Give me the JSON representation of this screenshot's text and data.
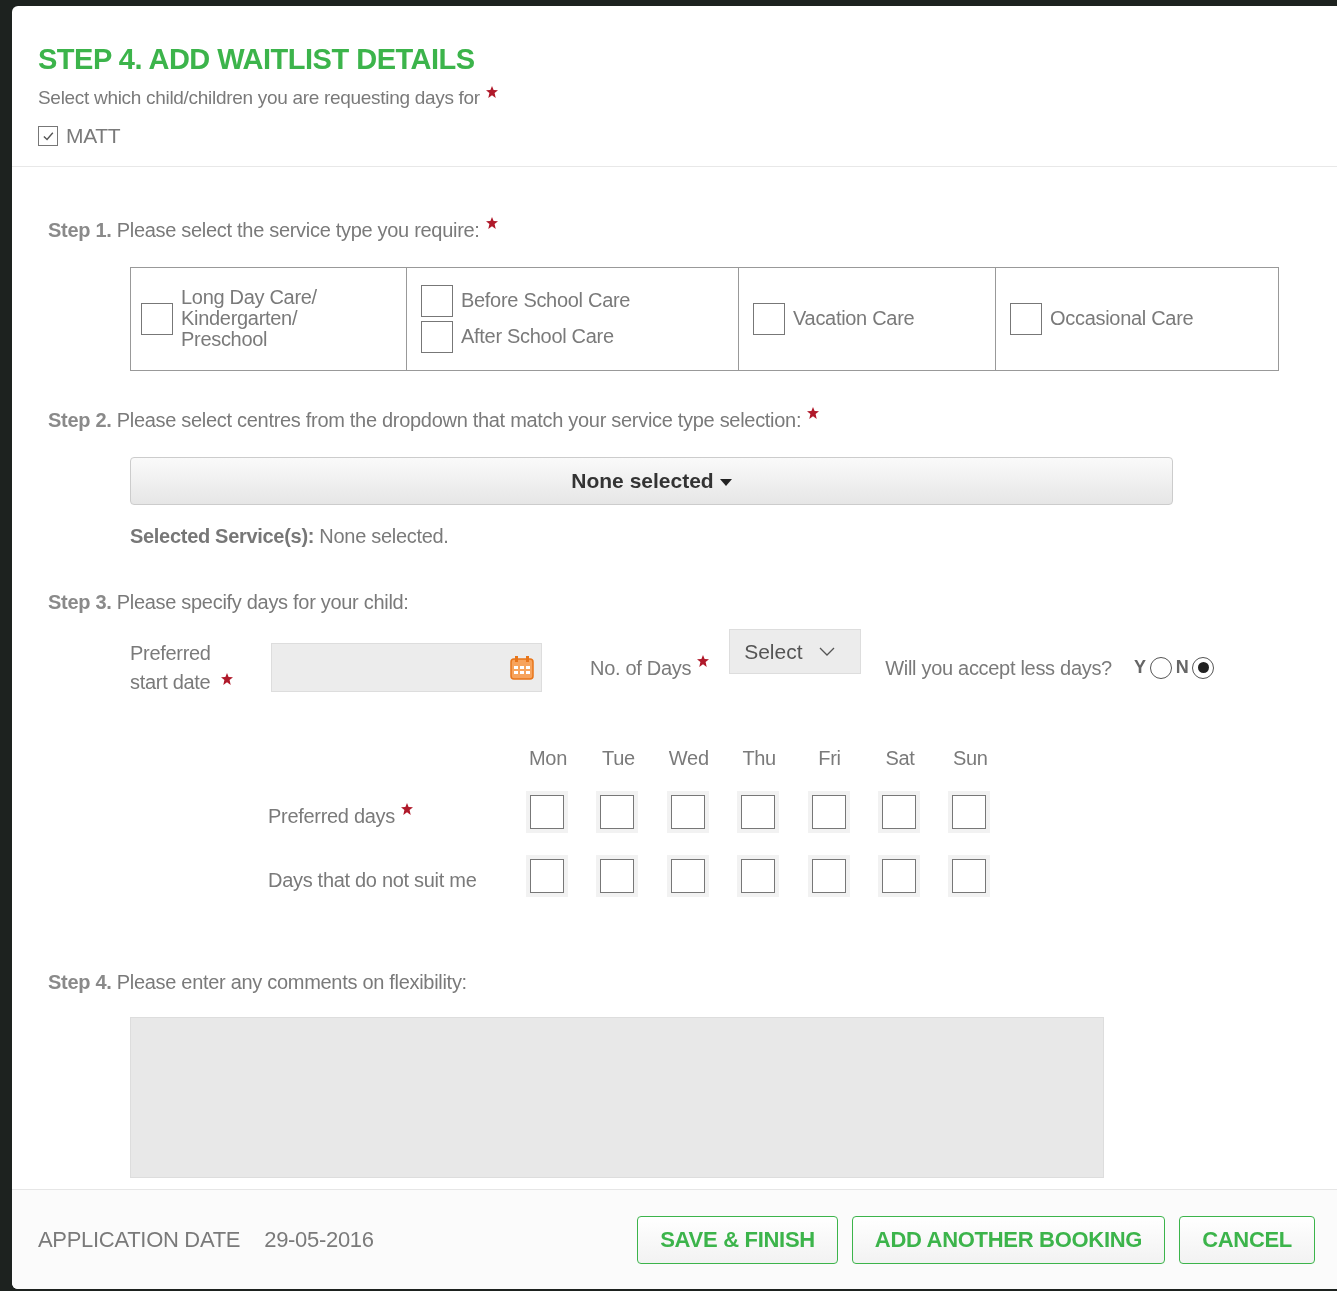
{
  "header": {
    "title": "STEP 4. ADD WAITLIST DETAILS",
    "prompt": "Select which child/children you are requesting days for",
    "prompt_required": true,
    "children": [
      {
        "label": "MATT",
        "checked": true
      }
    ]
  },
  "step1": {
    "number": "Step 1.",
    "text": "Please select the service type you require:",
    "required": true,
    "groups": [
      [
        {
          "label": "Long Day Care/ Kindergarten/ Preschool",
          "checked": false
        }
      ],
      [
        {
          "label": "Before School Care",
          "checked": false
        },
        {
          "label": "After School Care",
          "checked": false
        }
      ],
      [
        {
          "label": "Vacation Care",
          "checked": false
        }
      ],
      [
        {
          "label": "Occasional Care",
          "checked": false
        }
      ]
    ]
  },
  "step2": {
    "number": "Step 2.",
    "text": "Please select centres from the dropdown that match your service type selection:",
    "required": true,
    "dropdown": "None selected",
    "selected_label": "Selected Service(s):",
    "selected_value": "None selected."
  },
  "step3": {
    "number": "Step 3.",
    "text": "Please specify days for your child:",
    "start_date": {
      "label": "Preferred start date",
      "required": true
    },
    "days_count": {
      "label": "No. of Days",
      "required": true,
      "value": "Select"
    },
    "accept_less": {
      "question": "Will you accept less days?",
      "options": [
        {
          "label": "Y",
          "selected": false
        },
        {
          "label": "N",
          "selected": true
        }
      ]
    },
    "days": [
      "Mon",
      "Tue",
      "Wed",
      "Thu",
      "Fri",
      "Sat",
      "Sun"
    ],
    "rows": [
      {
        "label": "Preferred days",
        "required": true,
        "checked": [
          false,
          false,
          false,
          false,
          false,
          false,
          false
        ]
      },
      {
        "label": "Days that do not suit me",
        "required": false,
        "checked": [
          false,
          false,
          false,
          false,
          false,
          false,
          false
        ]
      }
    ]
  },
  "step4": {
    "number": "Step 4.",
    "text": "Please enter any comments on flexibility:"
  },
  "footer": {
    "label": "APPLICATION DATE",
    "date": "29-05-2016",
    "buttons": [
      "SAVE & FINISH",
      "ADD ANOTHER BOOKING",
      "CANCEL"
    ]
  }
}
